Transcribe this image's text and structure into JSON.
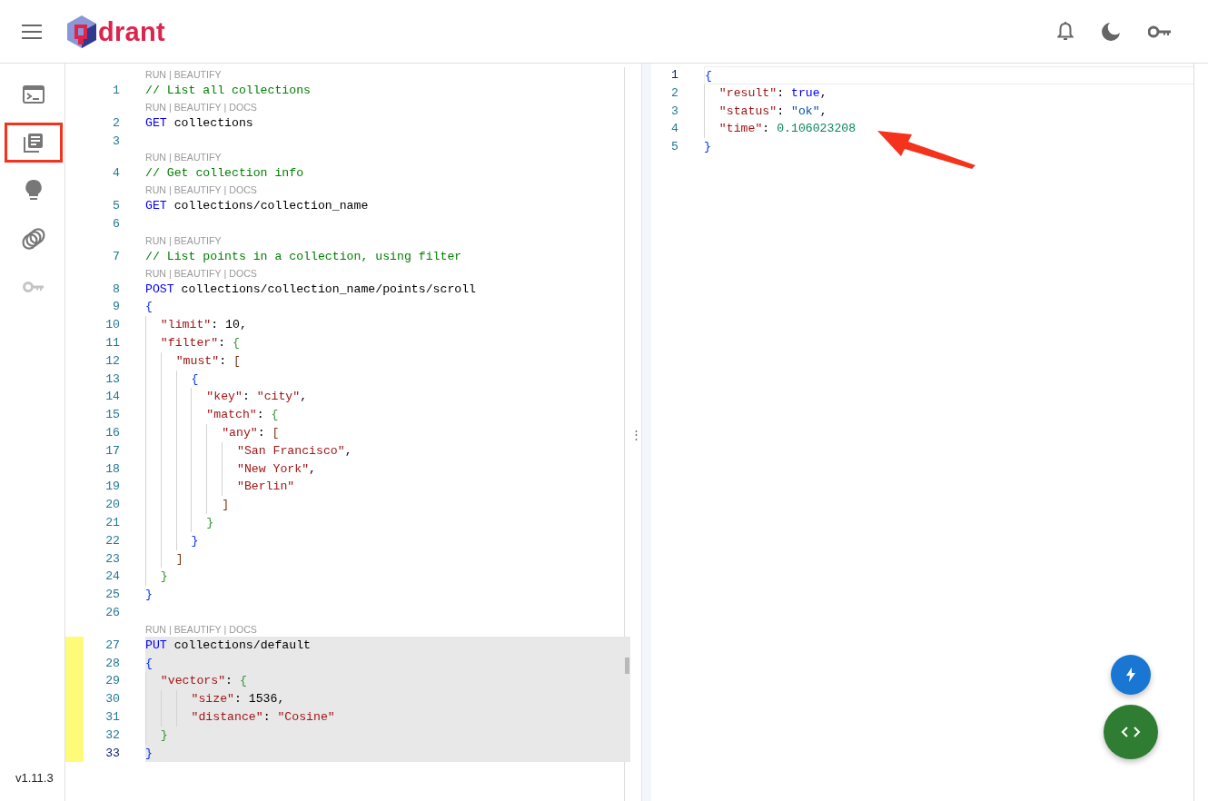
{
  "header": {
    "logo_text": "drant"
  },
  "sidebar": {
    "items": [
      {
        "kind": "console",
        "selected": false,
        "disabled": false
      },
      {
        "kind": "collections",
        "selected": true,
        "disabled": false
      },
      {
        "kind": "tutorial",
        "selected": false,
        "disabled": false
      },
      {
        "kind": "datasets",
        "selected": false,
        "disabled": false
      },
      {
        "kind": "access",
        "selected": false,
        "disabled": true
      }
    ],
    "version": "v1.11.3"
  },
  "editor": {
    "lens_separator": "|",
    "lines": [
      {
        "num": "1",
        "lens": [
          "RUN",
          "BEAUTIFY"
        ],
        "tokens": [
          {
            "text": "// List all collections",
            "kind": "comment"
          }
        ],
        "modified": false,
        "highlighted": false,
        "cursor": false
      },
      {
        "num": "2",
        "lens": [
          "RUN",
          "BEAUTIFY",
          "DOCS"
        ],
        "tokens": [
          {
            "text": "GET",
            "kind": "method"
          },
          {
            "text": " collections",
            "kind": "plain"
          }
        ],
        "modified": false,
        "highlighted": false,
        "cursor": false
      },
      {
        "num": "3",
        "modified": false,
        "highlighted": false,
        "cursor": false
      },
      {
        "num": "4",
        "lens": [
          "RUN",
          "BEAUTIFY"
        ],
        "tokens": [
          {
            "text": "// Get collection info",
            "kind": "comment"
          }
        ],
        "modified": false,
        "highlighted": false,
        "cursor": false
      },
      {
        "num": "5",
        "lens": [
          "RUN",
          "BEAUTIFY",
          "DOCS"
        ],
        "tokens": [
          {
            "text": "GET",
            "kind": "method"
          },
          {
            "text": " collections/collection_name",
            "kind": "plain"
          }
        ],
        "modified": false,
        "highlighted": false,
        "cursor": false
      },
      {
        "num": "6",
        "modified": false,
        "highlighted": false,
        "cursor": false
      },
      {
        "num": "7",
        "lens": [
          "RUN",
          "BEAUTIFY"
        ],
        "tokens": [
          {
            "text": "// List points in a collection, using filter",
            "kind": "comment"
          }
        ],
        "modified": false,
        "highlighted": false,
        "cursor": false
      },
      {
        "num": "8",
        "lens": [
          "RUN",
          "BEAUTIFY",
          "DOCS"
        ],
        "tokens": [
          {
            "text": "POST",
            "kind": "method"
          },
          {
            "text": " collections/collection_name/points/scroll",
            "kind": "plain"
          }
        ],
        "modified": false,
        "highlighted": false,
        "cursor": false
      },
      {
        "num": "9",
        "tokens": [
          {
            "text": "{",
            "kind": "bracket1"
          }
        ],
        "modified": false,
        "highlighted": false,
        "cursor": false
      },
      {
        "num": "10",
        "tokens": [
          {
            "text": "  \"limit\"",
            "kind": "key"
          },
          {
            "text": ": 10,",
            "kind": "plain"
          }
        ],
        "modified": false,
        "highlighted": false,
        "cursor": false
      },
      {
        "num": "11",
        "tokens": [
          {
            "text": "  \"filter\"",
            "kind": "key"
          },
          {
            "text": ": ",
            "kind": "plain"
          },
          {
            "text": "{",
            "kind": "bracket2"
          }
        ],
        "modified": false,
        "highlighted": false,
        "cursor": false
      },
      {
        "num": "12",
        "tokens": [
          {
            "text": "    \"must\"",
            "kind": "key"
          },
          {
            "text": ": ",
            "kind": "plain"
          },
          {
            "text": "[",
            "kind": "bracket3"
          }
        ],
        "modified": false,
        "highlighted": false,
        "cursor": false
      },
      {
        "num": "13",
        "tokens": [
          {
            "text": "      {",
            "kind": "bracket1"
          }
        ],
        "modified": false,
        "highlighted": false,
        "cursor": false
      },
      {
        "num": "14",
        "tokens": [
          {
            "text": "        \"key\"",
            "kind": "key"
          },
          {
            "text": ": ",
            "kind": "plain"
          },
          {
            "text": "\"city\"",
            "kind": "string"
          },
          {
            "text": ",",
            "kind": "plain"
          }
        ],
        "modified": false,
        "highlighted": false,
        "cursor": false
      },
      {
        "num": "15",
        "tokens": [
          {
            "text": "        \"match\"",
            "kind": "key"
          },
          {
            "text": ": ",
            "kind": "plain"
          },
          {
            "text": "{",
            "kind": "bracket2"
          }
        ],
        "modified": false,
        "highlighted": false,
        "cursor": false
      },
      {
        "num": "16",
        "tokens": [
          {
            "text": "          \"any\"",
            "kind": "key"
          },
          {
            "text": ": ",
            "kind": "plain"
          },
          {
            "text": "[",
            "kind": "bracket3"
          }
        ],
        "modified": false,
        "highlighted": false,
        "cursor": false
      },
      {
        "num": "17",
        "tokens": [
          {
            "text": "            \"San Francisco\"",
            "kind": "string"
          },
          {
            "text": ",",
            "kind": "plain"
          }
        ],
        "modified": false,
        "highlighted": false,
        "cursor": false
      },
      {
        "num": "18",
        "tokens": [
          {
            "text": "            \"New York\"",
            "kind": "string"
          },
          {
            "text": ",",
            "kind": "plain"
          }
        ],
        "modified": false,
        "highlighted": false,
        "cursor": false
      },
      {
        "num": "19",
        "tokens": [
          {
            "text": "            \"Berlin\"",
            "kind": "string"
          }
        ],
        "modified": false,
        "highlighted": false,
        "cursor": false
      },
      {
        "num": "20",
        "tokens": [
          {
            "text": "          ]",
            "kind": "bracket3"
          }
        ],
        "modified": false,
        "highlighted": false,
        "cursor": false
      },
      {
        "num": "21",
        "tokens": [
          {
            "text": "        }",
            "kind": "bracket2"
          }
        ],
        "modified": false,
        "highlighted": false,
        "cursor": false
      },
      {
        "num": "22",
        "tokens": [
          {
            "text": "      }",
            "kind": "bracket1"
          }
        ],
        "modified": false,
        "highlighted": false,
        "cursor": false
      },
      {
        "num": "23",
        "tokens": [
          {
            "text": "    ]",
            "kind": "bracket3"
          }
        ],
        "modified": false,
        "highlighted": false,
        "cursor": false
      },
      {
        "num": "24",
        "tokens": [
          {
            "text": "  }",
            "kind": "bracket2"
          }
        ],
        "modified": false,
        "highlighted": false,
        "cursor": false
      },
      {
        "num": "25",
        "tokens": [
          {
            "text": "}",
            "kind": "bracket1"
          }
        ],
        "modified": false,
        "highlighted": false,
        "cursor": false
      },
      {
        "num": "26",
        "modified": false,
        "highlighted": false,
        "cursor": false
      },
      {
        "num": "27",
        "lens": [
          "RUN",
          "BEAUTIFY",
          "DOCS"
        ],
        "tokens": [
          {
            "text": "PUT",
            "kind": "method"
          },
          {
            "text": " collections/default",
            "kind": "plain"
          }
        ],
        "modified": true,
        "highlighted": true,
        "cursor": false
      },
      {
        "num": "28",
        "tokens": [
          {
            "text": "{",
            "kind": "bracket1"
          }
        ],
        "modified": true,
        "highlighted": true,
        "cursor": false
      },
      {
        "num": "29",
        "tokens": [
          {
            "text": "  \"vectors\"",
            "kind": "key"
          },
          {
            "text": ": ",
            "kind": "plain"
          },
          {
            "text": "{",
            "kind": "bracket2"
          }
        ],
        "modified": true,
        "highlighted": true,
        "cursor": false
      },
      {
        "num": "30",
        "tokens": [
          {
            "text": "      \"size\"",
            "kind": "key"
          },
          {
            "text": ": 1536,",
            "kind": "plain"
          }
        ],
        "modified": true,
        "highlighted": true,
        "cursor": false
      },
      {
        "num": "31",
        "tokens": [
          {
            "text": "      \"distance\"",
            "kind": "key"
          },
          {
            "text": ": ",
            "kind": "plain"
          },
          {
            "text": "\"Cosine\"",
            "kind": "string"
          }
        ],
        "modified": true,
        "highlighted": true,
        "cursor": false
      },
      {
        "num": "32",
        "tokens": [
          {
            "text": "  }",
            "kind": "bracket2"
          }
        ],
        "modified": true,
        "highlighted": true,
        "cursor": false
      },
      {
        "num": "33",
        "tokens": [
          {
            "text": "}",
            "kind": "bracket1"
          }
        ],
        "modified": true,
        "highlighted": true,
        "cursor": true
      }
    ]
  },
  "splitter_handle": "⋮",
  "result": {
    "lines": [
      {
        "num": "1",
        "tokens": [
          {
            "text": "{",
            "kind": "bracket1"
          }
        ],
        "cursor": true
      },
      {
        "num": "2",
        "tokens": [
          {
            "text": "  \"result\"",
            "kind": "key"
          },
          {
            "text": ": ",
            "kind": "plain"
          },
          {
            "text": "true",
            "kind": "keyword"
          },
          {
            "text": ",",
            "kind": "plain"
          }
        ],
        "cursor": false
      },
      {
        "num": "3",
        "tokens": [
          {
            "text": "  \"status\"",
            "kind": "key"
          },
          {
            "text": ": ",
            "kind": "plain"
          },
          {
            "text": "\"ok\"",
            "kind": "value-string"
          },
          {
            "text": ",",
            "kind": "plain"
          }
        ],
        "cursor": false
      },
      {
        "num": "4",
        "tokens": [
          {
            "text": "  \"time\"",
            "kind": "key"
          },
          {
            "text": ": ",
            "kind": "plain"
          },
          {
            "text": "0.106023208",
            "kind": "value-number"
          }
        ],
        "cursor": false
      },
      {
        "num": "5",
        "tokens": [
          {
            "text": "}",
            "kind": "bracket1"
          }
        ],
        "cursor": false
      }
    ]
  }
}
